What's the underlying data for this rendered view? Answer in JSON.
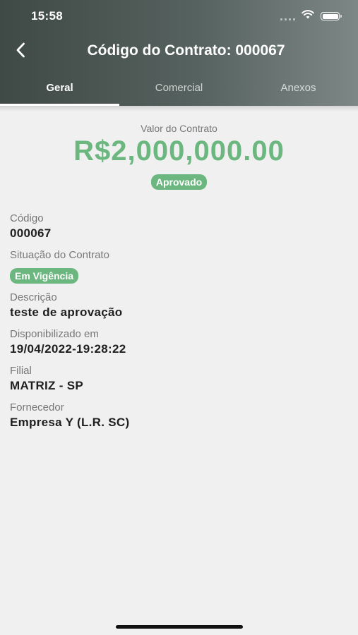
{
  "status_bar": {
    "time": "15:58",
    "icons": [
      "signal-icon",
      "wifi-icon",
      "battery-icon"
    ]
  },
  "nav": {
    "back_icon": "chevron-left-icon",
    "title": "Código do Contrato: 000067"
  },
  "tabs": [
    {
      "label": "Geral",
      "active": true
    },
    {
      "label": "Comercial",
      "active": false
    },
    {
      "label": "Anexos",
      "active": false
    }
  ],
  "summary": {
    "value_label": "Valor do Contrato",
    "value_amount": "R$2,000,000.00",
    "status_badge": "Aprovado"
  },
  "fields": {
    "codigo": {
      "label": "Código",
      "value": "000067"
    },
    "situacao": {
      "label": "Situação do Contrato",
      "badge": "Em Vigência"
    },
    "descricao": {
      "label": "Descrição",
      "value": "teste de aprovação"
    },
    "disponibilizado": {
      "label": "Disponibilizado em",
      "value": "19/04/2022-19:28:22"
    },
    "filial": {
      "label": "Filial",
      "value": "MATRIZ - SP"
    },
    "fornecedor": {
      "label": "Fornecedor",
      "value": "Empresa Y (L.R. SC)"
    }
  },
  "colors": {
    "header_start": "#3f4946",
    "header_end": "#7d8886",
    "accent_green": "#6bb77f",
    "background": "#f0f0f0"
  }
}
